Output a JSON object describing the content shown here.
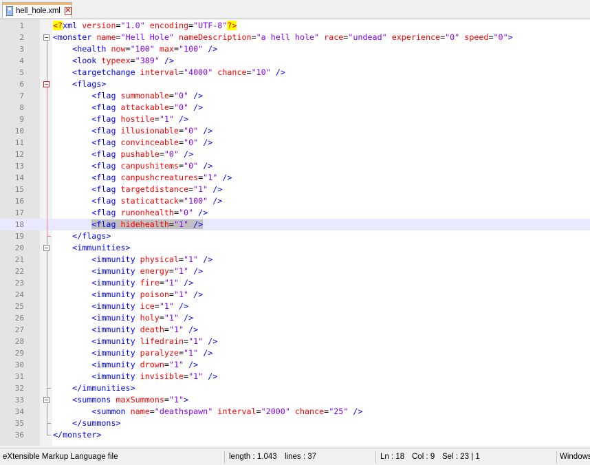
{
  "tab": {
    "title": "hell_hole.xml",
    "icon": "file-save-icon",
    "close": "✕"
  },
  "colors": {
    "tag": "#0000ff",
    "attr": "#ff0000",
    "value": "#8000ff",
    "selection": "#c0c0c0",
    "current_line": "#e8e8ff"
  },
  "editor": {
    "current_line": 18,
    "lines": [
      {
        "n": "1",
        "indent": "",
        "parts": [
          [
            "d",
            "<?"
          ],
          [
            "t",
            "xml "
          ],
          [
            "a",
            "version"
          ],
          [
            "p",
            "="
          ],
          [
            "v",
            "\"1.0\""
          ],
          [
            "p",
            " "
          ],
          [
            "a",
            "encoding"
          ],
          [
            "p",
            "="
          ],
          [
            "v",
            "\"UTF-8\""
          ],
          [
            "d",
            "?>"
          ]
        ]
      },
      {
        "n": "2",
        "indent": "",
        "parts": [
          [
            "t",
            "<monster "
          ],
          [
            "a",
            "name"
          ],
          [
            "p",
            "="
          ],
          [
            "v",
            "\"Hell Hole\""
          ],
          [
            "p",
            " "
          ],
          [
            "a",
            "nameDescription"
          ],
          [
            "p",
            "="
          ],
          [
            "v",
            "\"a hell hole\""
          ],
          [
            "p",
            " "
          ],
          [
            "a",
            "race"
          ],
          [
            "p",
            "="
          ],
          [
            "v",
            "\"undead\""
          ],
          [
            "p",
            " "
          ],
          [
            "a",
            "experience"
          ],
          [
            "p",
            "="
          ],
          [
            "v",
            "\"0\""
          ],
          [
            "p",
            " "
          ],
          [
            "a",
            "speed"
          ],
          [
            "p",
            "="
          ],
          [
            "v",
            "\"0\""
          ],
          [
            "t",
            ">"
          ]
        ]
      },
      {
        "n": "3",
        "indent": "    ",
        "parts": [
          [
            "t",
            "<health "
          ],
          [
            "a",
            "now"
          ],
          [
            "p",
            "="
          ],
          [
            "v",
            "\"100\""
          ],
          [
            "p",
            " "
          ],
          [
            "a",
            "max"
          ],
          [
            "p",
            "="
          ],
          [
            "v",
            "\"100\""
          ],
          [
            "p",
            " "
          ],
          [
            "t",
            "/>"
          ]
        ]
      },
      {
        "n": "4",
        "indent": "    ",
        "parts": [
          [
            "t",
            "<look "
          ],
          [
            "a",
            "typeex"
          ],
          [
            "p",
            "="
          ],
          [
            "v",
            "\"389\""
          ],
          [
            "p",
            " "
          ],
          [
            "t",
            "/>"
          ]
        ]
      },
      {
        "n": "5",
        "indent": "    ",
        "parts": [
          [
            "t",
            "<targetchange "
          ],
          [
            "a",
            "interval"
          ],
          [
            "p",
            "="
          ],
          [
            "v",
            "\"4000\""
          ],
          [
            "p",
            " "
          ],
          [
            "a",
            "chance"
          ],
          [
            "p",
            "="
          ],
          [
            "v",
            "\"10\""
          ],
          [
            "p",
            " "
          ],
          [
            "t",
            "/>"
          ]
        ]
      },
      {
        "n": "6",
        "indent": "    ",
        "parts": [
          [
            "t",
            "<flags>"
          ]
        ]
      },
      {
        "n": "7",
        "indent": "        ",
        "parts": [
          [
            "t",
            "<flag "
          ],
          [
            "a",
            "summonable"
          ],
          [
            "p",
            "="
          ],
          [
            "v",
            "\"0\""
          ],
          [
            "p",
            " "
          ],
          [
            "t",
            "/>"
          ]
        ]
      },
      {
        "n": "8",
        "indent": "        ",
        "parts": [
          [
            "t",
            "<flag "
          ],
          [
            "a",
            "attackable"
          ],
          [
            "p",
            "="
          ],
          [
            "v",
            "\"0\""
          ],
          [
            "p",
            " "
          ],
          [
            "t",
            "/>"
          ]
        ]
      },
      {
        "n": "9",
        "indent": "        ",
        "parts": [
          [
            "t",
            "<flag "
          ],
          [
            "a",
            "hostile"
          ],
          [
            "p",
            "="
          ],
          [
            "v",
            "\"1\""
          ],
          [
            "p",
            " "
          ],
          [
            "t",
            "/>"
          ]
        ]
      },
      {
        "n": "10",
        "indent": "        ",
        "parts": [
          [
            "t",
            "<flag "
          ],
          [
            "a",
            "illusionable"
          ],
          [
            "p",
            "="
          ],
          [
            "v",
            "\"0\""
          ],
          [
            "p",
            " "
          ],
          [
            "t",
            "/>"
          ]
        ]
      },
      {
        "n": "11",
        "indent": "        ",
        "parts": [
          [
            "t",
            "<flag "
          ],
          [
            "a",
            "convinceable"
          ],
          [
            "p",
            "="
          ],
          [
            "v",
            "\"0\""
          ],
          [
            "p",
            " "
          ],
          [
            "t",
            "/>"
          ]
        ]
      },
      {
        "n": "12",
        "indent": "        ",
        "parts": [
          [
            "t",
            "<flag "
          ],
          [
            "a",
            "pushable"
          ],
          [
            "p",
            "="
          ],
          [
            "v",
            "\"0\""
          ],
          [
            "p",
            " "
          ],
          [
            "t",
            "/>"
          ]
        ]
      },
      {
        "n": "13",
        "indent": "        ",
        "parts": [
          [
            "t",
            "<flag "
          ],
          [
            "a",
            "canpushitems"
          ],
          [
            "p",
            "="
          ],
          [
            "v",
            "\"0\""
          ],
          [
            "p",
            " "
          ],
          [
            "t",
            "/>"
          ]
        ]
      },
      {
        "n": "14",
        "indent": "        ",
        "parts": [
          [
            "t",
            "<flag "
          ],
          [
            "a",
            "canpushcreatures"
          ],
          [
            "p",
            "="
          ],
          [
            "v",
            "\"1\""
          ],
          [
            "p",
            " "
          ],
          [
            "t",
            "/>"
          ]
        ]
      },
      {
        "n": "15",
        "indent": "        ",
        "parts": [
          [
            "t",
            "<flag "
          ],
          [
            "a",
            "targetdistance"
          ],
          [
            "p",
            "="
          ],
          [
            "v",
            "\"1\""
          ],
          [
            "p",
            " "
          ],
          [
            "t",
            "/>"
          ]
        ]
      },
      {
        "n": "16",
        "indent": "        ",
        "parts": [
          [
            "t",
            "<flag "
          ],
          [
            "a",
            "staticattack"
          ],
          [
            "p",
            "="
          ],
          [
            "v",
            "\"100\""
          ],
          [
            "p",
            " "
          ],
          [
            "t",
            "/>"
          ]
        ]
      },
      {
        "n": "17",
        "indent": "        ",
        "parts": [
          [
            "t",
            "<flag "
          ],
          [
            "a",
            "runonhealth"
          ],
          [
            "p",
            "="
          ],
          [
            "v",
            "\"0\""
          ],
          [
            "p",
            " "
          ],
          [
            "t",
            "/>"
          ]
        ]
      },
      {
        "n": "18",
        "indent": "        ",
        "selected": true,
        "parts": [
          [
            "t",
            "<flag "
          ],
          [
            "a",
            "hidehealth"
          ],
          [
            "p",
            "="
          ],
          [
            "v",
            "\"1\""
          ],
          [
            "p",
            " "
          ],
          [
            "t",
            "/>"
          ]
        ]
      },
      {
        "n": "19",
        "indent": "    ",
        "parts": [
          [
            "t",
            "</flags>"
          ]
        ]
      },
      {
        "n": "20",
        "indent": "    ",
        "parts": [
          [
            "t",
            "<immunities>"
          ]
        ]
      },
      {
        "n": "21",
        "indent": "        ",
        "parts": [
          [
            "t",
            "<immunity "
          ],
          [
            "a",
            "physical"
          ],
          [
            "p",
            "="
          ],
          [
            "v",
            "\"1\""
          ],
          [
            "p",
            " "
          ],
          [
            "t",
            "/>"
          ]
        ]
      },
      {
        "n": "22",
        "indent": "        ",
        "parts": [
          [
            "t",
            "<immunity "
          ],
          [
            "a",
            "energy"
          ],
          [
            "p",
            "="
          ],
          [
            "v",
            "\"1\""
          ],
          [
            "p",
            " "
          ],
          [
            "t",
            "/>"
          ]
        ]
      },
      {
        "n": "23",
        "indent": "        ",
        "parts": [
          [
            "t",
            "<immunity "
          ],
          [
            "a",
            "fire"
          ],
          [
            "p",
            "="
          ],
          [
            "v",
            "\"1\""
          ],
          [
            "p",
            " "
          ],
          [
            "t",
            "/>"
          ]
        ]
      },
      {
        "n": "24",
        "indent": "        ",
        "parts": [
          [
            "t",
            "<immunity "
          ],
          [
            "a",
            "poison"
          ],
          [
            "p",
            "="
          ],
          [
            "v",
            "\"1\""
          ],
          [
            "p",
            " "
          ],
          [
            "t",
            "/>"
          ]
        ]
      },
      {
        "n": "25",
        "indent": "        ",
        "parts": [
          [
            "t",
            "<immunity "
          ],
          [
            "a",
            "ice"
          ],
          [
            "p",
            "="
          ],
          [
            "v",
            "\"1\""
          ],
          [
            "p",
            " "
          ],
          [
            "t",
            "/>"
          ]
        ]
      },
      {
        "n": "26",
        "indent": "        ",
        "parts": [
          [
            "t",
            "<immunity "
          ],
          [
            "a",
            "holy"
          ],
          [
            "p",
            "="
          ],
          [
            "v",
            "\"1\""
          ],
          [
            "p",
            " "
          ],
          [
            "t",
            "/>"
          ]
        ]
      },
      {
        "n": "27",
        "indent": "        ",
        "parts": [
          [
            "t",
            "<immunity "
          ],
          [
            "a",
            "death"
          ],
          [
            "p",
            "="
          ],
          [
            "v",
            "\"1\""
          ],
          [
            "p",
            " "
          ],
          [
            "t",
            "/>"
          ]
        ]
      },
      {
        "n": "28",
        "indent": "        ",
        "parts": [
          [
            "t",
            "<immunity "
          ],
          [
            "a",
            "lifedrain"
          ],
          [
            "p",
            "="
          ],
          [
            "v",
            "\"1\""
          ],
          [
            "p",
            " "
          ],
          [
            "t",
            "/>"
          ]
        ]
      },
      {
        "n": "29",
        "indent": "        ",
        "parts": [
          [
            "t",
            "<immunity "
          ],
          [
            "a",
            "paralyze"
          ],
          [
            "p",
            "="
          ],
          [
            "v",
            "\"1\""
          ],
          [
            "p",
            " "
          ],
          [
            "t",
            "/>"
          ]
        ]
      },
      {
        "n": "30",
        "indent": "        ",
        "parts": [
          [
            "t",
            "<immunity "
          ],
          [
            "a",
            "drown"
          ],
          [
            "p",
            "="
          ],
          [
            "v",
            "\"1\""
          ],
          [
            "p",
            " "
          ],
          [
            "t",
            "/>"
          ]
        ]
      },
      {
        "n": "31",
        "indent": "        ",
        "parts": [
          [
            "t",
            "<immunity "
          ],
          [
            "a",
            "invisible"
          ],
          [
            "p",
            "="
          ],
          [
            "v",
            "\"1\""
          ],
          [
            "p",
            " "
          ],
          [
            "t",
            "/>"
          ]
        ]
      },
      {
        "n": "32",
        "indent": "    ",
        "parts": [
          [
            "t",
            "</immunities>"
          ]
        ]
      },
      {
        "n": "33",
        "indent": "    ",
        "parts": [
          [
            "t",
            "<summons "
          ],
          [
            "a",
            "maxSummons"
          ],
          [
            "p",
            "="
          ],
          [
            "v",
            "\"1\""
          ],
          [
            "t",
            ">"
          ]
        ]
      },
      {
        "n": "34",
        "indent": "        ",
        "parts": [
          [
            "t",
            "<summon "
          ],
          [
            "a",
            "name"
          ],
          [
            "p",
            "="
          ],
          [
            "v",
            "\"deathspawn\""
          ],
          [
            "p",
            " "
          ],
          [
            "a",
            "interval"
          ],
          [
            "p",
            "="
          ],
          [
            "v",
            "\"2000\""
          ],
          [
            "p",
            " "
          ],
          [
            "a",
            "chance"
          ],
          [
            "p",
            "="
          ],
          [
            "v",
            "\"25\""
          ],
          [
            "p",
            " "
          ],
          [
            "t",
            "/>"
          ]
        ]
      },
      {
        "n": "35",
        "indent": "    ",
        "parts": [
          [
            "t",
            "</summons>"
          ]
        ]
      },
      {
        "n": "36",
        "indent": "",
        "parts": [
          [
            "t",
            "</monster>"
          ]
        ]
      }
    ]
  },
  "status": {
    "language": "eXtensible Markup Language file",
    "length": "length : 1.043",
    "lines": "lines : 37",
    "ln": "Ln : 18",
    "col": "Col : 9",
    "sel": "Sel : 23 | 1",
    "eol": "Windows"
  }
}
